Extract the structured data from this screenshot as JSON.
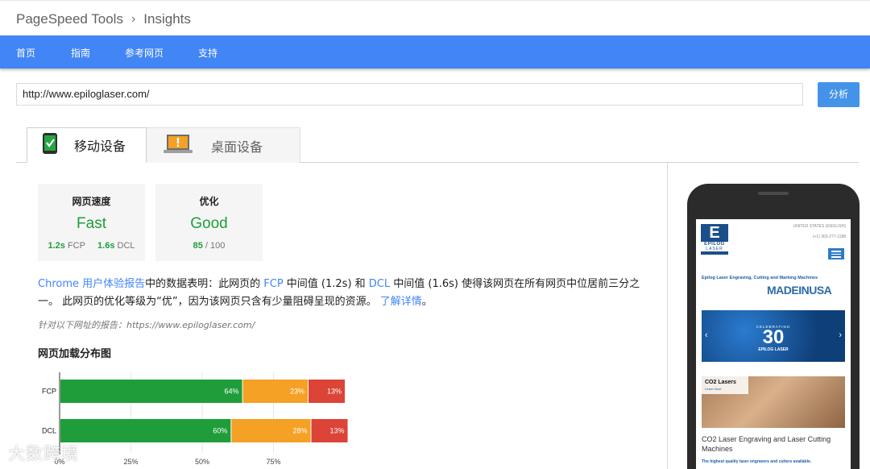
{
  "breadcrumb": {
    "part1": "PageSpeed Tools",
    "sep": "›",
    "part2": "Insights"
  },
  "nav": {
    "items": [
      "首页",
      "指南",
      "参考网页",
      "支持"
    ]
  },
  "search": {
    "url": "http://www.epiloglaser.com/",
    "button": "分析"
  },
  "tabs": [
    {
      "label": "移动设备",
      "icon": "mobile-check-icon"
    },
    {
      "label": "桌面设备",
      "icon": "laptop-warning-icon"
    }
  ],
  "speed": {
    "label": "网页速度",
    "value": "Fast",
    "fcp": "1.2s",
    "fcp_label": "FCP",
    "dcl": "1.6s",
    "dcl_label": "DCL"
  },
  "optimization": {
    "label": "优化",
    "value": "Good",
    "score": "85",
    "total": "/ 100"
  },
  "summary": {
    "link1": "Chrome 用户体验报告",
    "t1": "中的数据表明：此网页的 ",
    "link2": "FCP",
    "t2": " 中间值 (1.2s) 和 ",
    "link3": "DCL",
    "t3": " 中间值 (1.6s) 使得该网页在所有网页中位居前三分之一。 此网页的优化等级为“优”，因为该网页只含有少量阻碍呈现的资源。 ",
    "link4": "了解详情",
    "t4": "。"
  },
  "report_url": "针对以下网址的报告：https://www.epiloglaser.com/",
  "distribution_title": "网页加载分布图",
  "chart_data": {
    "type": "bar",
    "orientation": "horizontal-stacked",
    "categories": [
      "FCP",
      "DCL"
    ],
    "series": [
      {
        "name": "",
        "color": "#1f9d3a",
        "values": [
          64,
          60
        ]
      },
      {
        "name": "",
        "color": "#f4a125",
        "values": [
          23,
          28
        ]
      },
      {
        "name": "",
        "color": "#db4437",
        "values": [
          13,
          13
        ]
      }
    ],
    "x_ticks": [
      "0%",
      "25%",
      "50%",
      "75%"
    ],
    "xlim": [
      0,
      100
    ]
  },
  "phone_preview": {
    "logo_top": "E",
    "logo_brand": "EPILOG",
    "logo_sub": "LASER",
    "header_line1": "UNITED STATES (ENGLISH)",
    "header_line2": "(+1) 303-277-1188",
    "tagline": "Epilog Laser Engraving, Cutting and Marking Machines",
    "made_in": "MADEINUSA",
    "banner_num": "30",
    "banner_small": "CELEBRATING",
    "banner_sub": "EPILOG LASER",
    "card_title": "CO2 Lasers",
    "card_sub": "Learn More",
    "caption": "CO2 Laser Engraving and Laser Cutting Machines",
    "footer": "The highest quality laser engravers and cutters available."
  },
  "watermark": "大数跨境"
}
